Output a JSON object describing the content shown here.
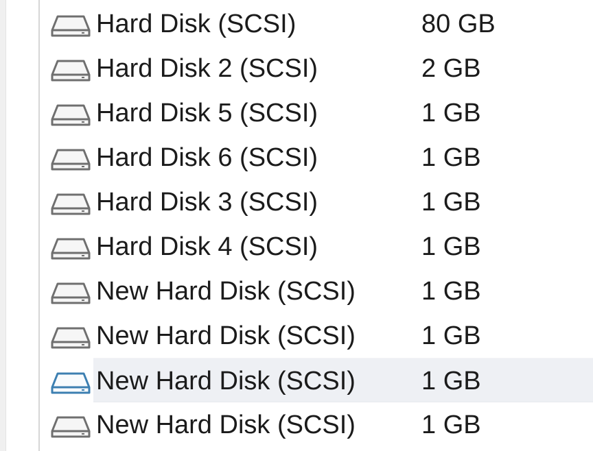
{
  "devices": [
    {
      "name": "Hard Disk (SCSI)",
      "size": "80 GB",
      "icon": "hard-disk-icon"
    },
    {
      "name": "Hard Disk 2 (SCSI)",
      "size": "2 GB",
      "icon": "hard-disk-icon"
    },
    {
      "name": "Hard Disk 5 (SCSI)",
      "size": "1 GB",
      "icon": "hard-disk-icon"
    },
    {
      "name": "Hard Disk 6 (SCSI)",
      "size": "1 GB",
      "icon": "hard-disk-icon"
    },
    {
      "name": "Hard Disk 3 (SCSI)",
      "size": "1 GB",
      "icon": "hard-disk-icon"
    },
    {
      "name": "Hard Disk 4 (SCSI)",
      "size": "1 GB",
      "icon": "hard-disk-icon"
    },
    {
      "name": "New Hard Disk (SCSI)",
      "size": "1 GB",
      "icon": "hard-disk-icon"
    },
    {
      "name": "New Hard Disk (SCSI)",
      "size": "1 GB",
      "icon": "hard-disk-icon"
    },
    {
      "name": "New Hard Disk (SCSI)",
      "size": "1 GB",
      "icon": "hard-disk-icon",
      "highlighted": true
    },
    {
      "name": "New Hard Disk (SCSI)",
      "size": "1 GB",
      "icon": "hard-disk-icon"
    }
  ],
  "colors": {
    "icon_outline": "#6f6f6f",
    "icon_outline_highlighted": "#3c7fb1",
    "highlight_background": "#eef0f4",
    "text": "#1b1b1b"
  }
}
